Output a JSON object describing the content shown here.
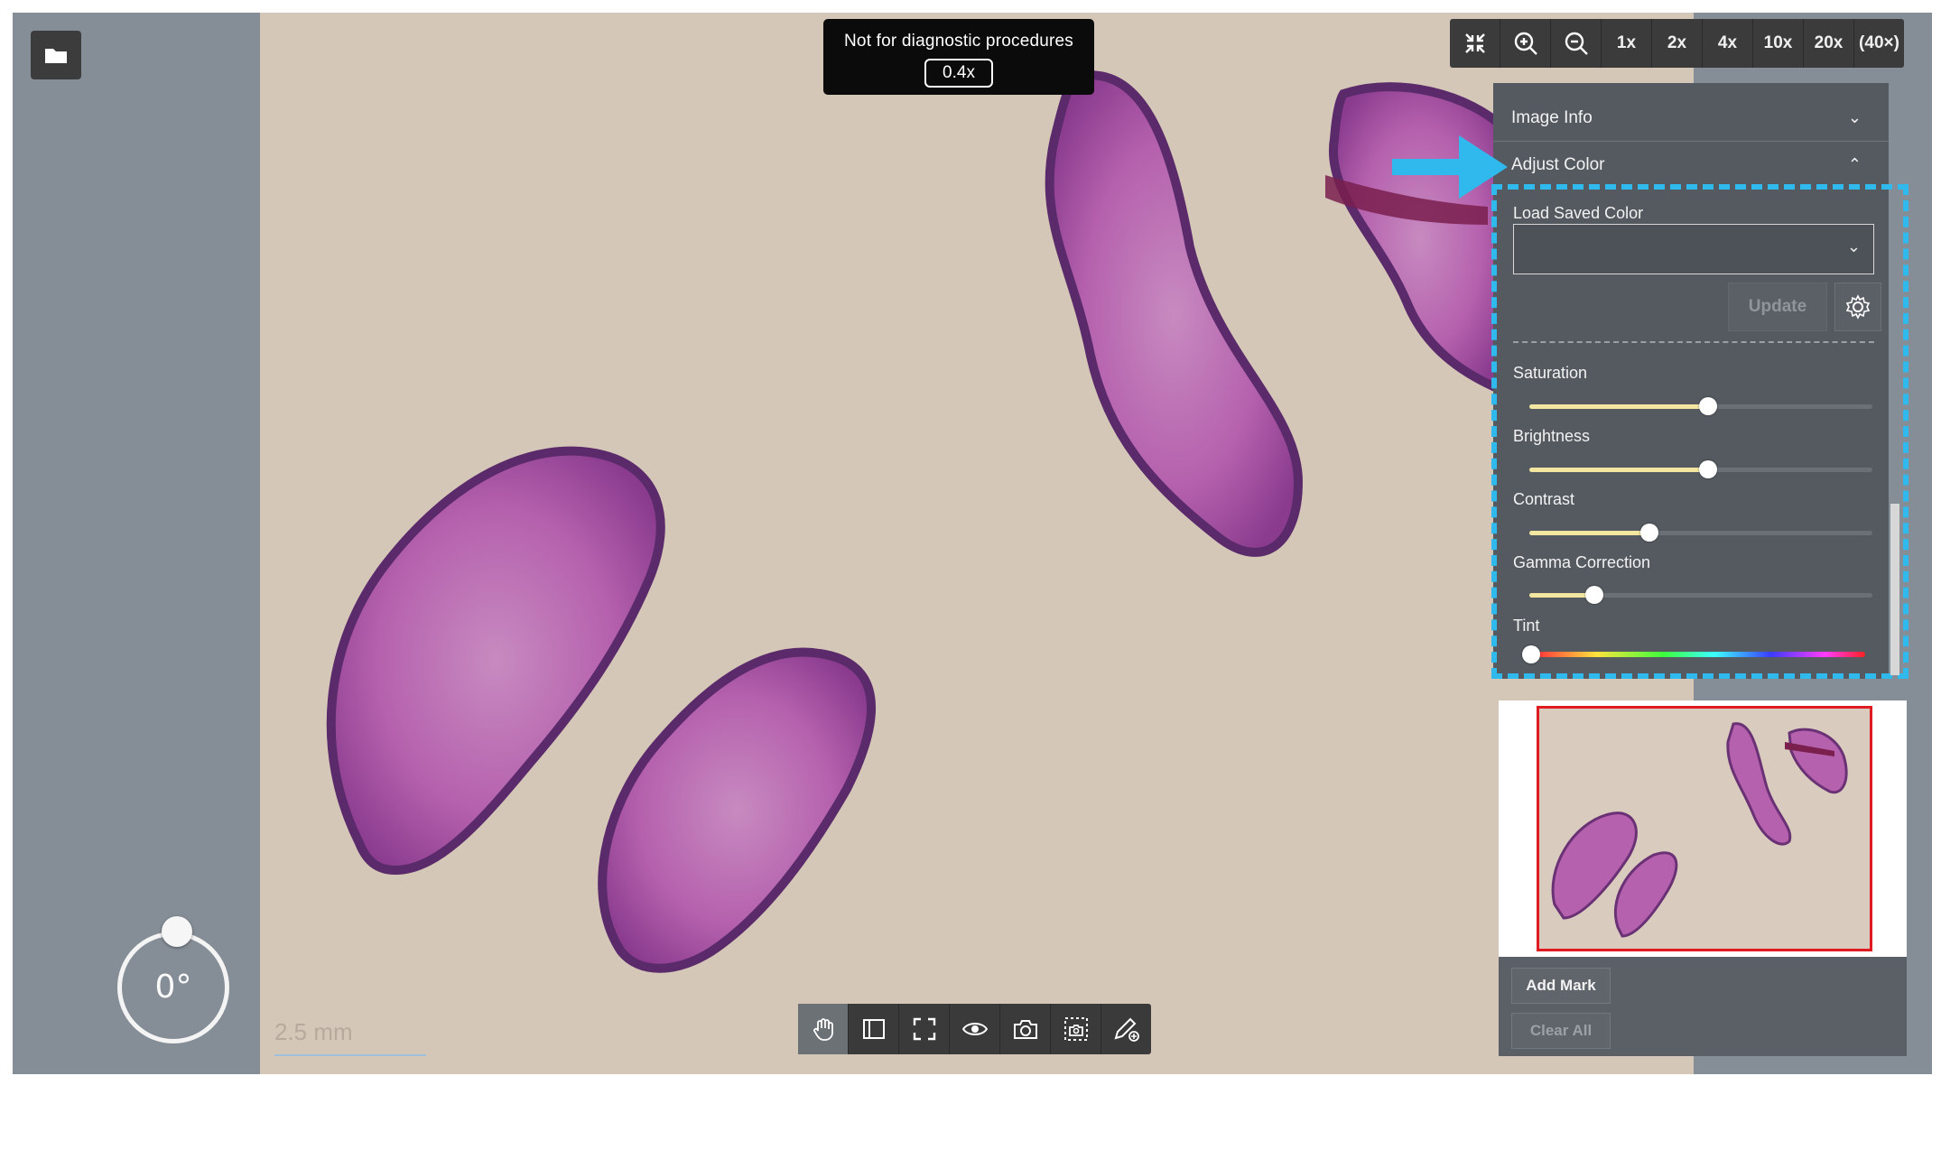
{
  "notice": {
    "text": "Not for diagnostic procedures",
    "zoom": "0.4x"
  },
  "rotation": {
    "value": "0°"
  },
  "scalebar": {
    "label": "2.5 mm"
  },
  "zoom_toolbar": {
    "icons": [
      "collapse-icon",
      "zoom-in-icon",
      "zoom-out-icon"
    ],
    "levels": [
      "1x",
      "2x",
      "4x",
      "10x",
      "20x",
      "(40×)"
    ]
  },
  "panel": {
    "image_info": "Image Info",
    "adjust_color": "Adjust Color",
    "load_saved_color": "Load Saved Color",
    "update": "Update",
    "saturation": {
      "label": "Saturation",
      "value": 0.52
    },
    "brightness": {
      "label": "Brightness",
      "value": 0.52
    },
    "contrast": {
      "label": "Contrast",
      "value": 0.35
    },
    "gamma": {
      "label": "Gamma Correction",
      "value": 0.19
    },
    "tint": {
      "label": "Tint",
      "value": 0.0
    }
  },
  "marks": {
    "add": "Add Mark",
    "clear": "Clear All"
  },
  "colors": {
    "highlight": "#2fb9ec",
    "viewport_box": "#e11b22",
    "slider_fill": "#f3e6a1"
  },
  "bottom_toolbar": {
    "icons": [
      "pan-hand-icon",
      "panel-toggle-icon",
      "fullscreen-icon",
      "eye-icon",
      "camera-icon",
      "region-capture-icon",
      "annotate-pen-icon"
    ]
  }
}
